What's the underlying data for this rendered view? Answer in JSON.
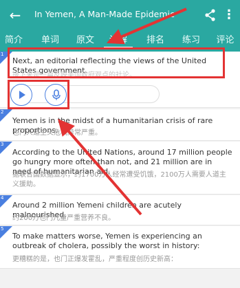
{
  "app": {
    "title": "In Yemen, A Man-Made Epidemic"
  },
  "icons": {
    "back": "arrow-left-icon",
    "share": "share-icon",
    "more": "more-vertical-icon",
    "play": "play-icon",
    "mic": "microphone-icon"
  },
  "tabs": [
    {
      "label": "简介"
    },
    {
      "label": "单词"
    },
    {
      "label": "原文"
    },
    {
      "label": "详解"
    },
    {
      "label": "排名"
    },
    {
      "label": "练习"
    },
    {
      "label": "评论"
    }
  ],
  "sentences": [
    {
      "num": "1",
      "en": "Next, an editorial reflecting the views of the United States government.",
      "zh": "接下来是一篇反映美国政府观点的社论。"
    },
    {
      "num": "2",
      "en": "Yemen is in the midst of a humanitarian crisis of rare proportions.",
      "zh": "也门人道主义危机异常严重。"
    },
    {
      "num": "3",
      "en": "According to the United Nations, around 17 million people go hungry more often than not, and 21 million are in need of humanitarian aid.",
      "zh": "据联合国数据显示，约1700万人经常遭受饥饿，2100万人需要人道主义援助。"
    },
    {
      "num": "4",
      "en": "Around 2 million Yemeni children are acutely malnourished.",
      "zh": "约200万也门儿童严重营养不良。"
    },
    {
      "num": "5",
      "en": "To make matters worse, Yemen is experiencing an outbreak of cholera, possibly the worst in history:",
      "zh": "更糟糕的是，也门正爆发霍乱，严重程度创历史新高："
    }
  ],
  "colors": {
    "primary": "#2aa8a1",
    "accent": "#4a7fe0",
    "annotation": "#e33333"
  }
}
